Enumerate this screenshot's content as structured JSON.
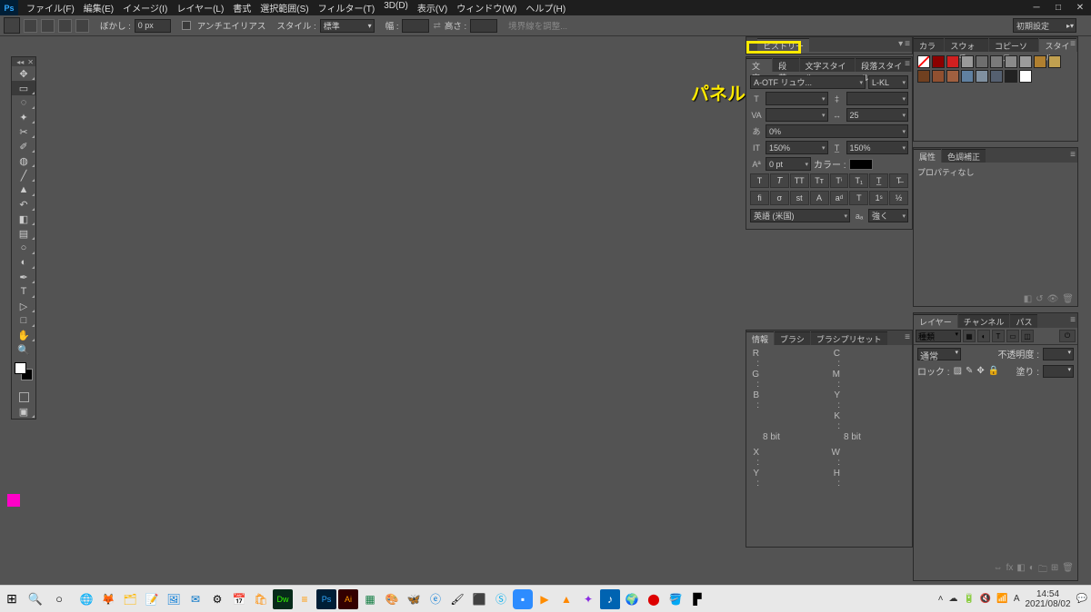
{
  "menu": {
    "file": "ファイル(F)",
    "edit": "編集(E)",
    "image": "イメージ(I)",
    "layer": "レイヤー(L)",
    "type": "書式",
    "select": "選択範囲(S)",
    "filter": "フィルター(T)",
    "threed": "3D(D)",
    "view": "表示(V)",
    "window": "ウィンドウ(W)",
    "help": "ヘルプ(H)"
  },
  "workspace": "初期設定",
  "options": {
    "feather_label": "ぼかし :",
    "feather_value": "0 px",
    "antialias": "アンチエイリアス",
    "style_label": "スタイル :",
    "style_value": "標準",
    "width_label": "幅 :",
    "width_value": "",
    "height_label": "高さ :",
    "height_value": "",
    "refine": "境界線を調整..."
  },
  "history_tab": "ヒストリー",
  "annotation": "パネルが最小化されました",
  "char_panel": {
    "tabs": [
      "文字",
      "段落",
      "文字スタイル",
      "段落スタイル"
    ],
    "font": "A-OTF リュウ...",
    "weight": "L-KL",
    "size": "",
    "leading": "",
    "va": "VA",
    "tracking": "25",
    "tsume": "0%",
    "vscale": "150%",
    "hscale": "150%",
    "baseline": "0 pt",
    "color_label": "カラー :",
    "lang": "英語 (米国)",
    "aa": "強く"
  },
  "info_panel": {
    "tabs": [
      "情報",
      "ブラシ",
      "ブラシプリセット"
    ],
    "r": "R :",
    "g": "G :",
    "b": "B :",
    "c": "C :",
    "m": "M :",
    "y": "Y :",
    "k": "K :",
    "bit": "8 bit",
    "bit2": "8 bit",
    "x": "X :",
    "yy": "Y :",
    "w": "W :",
    "h": "H :"
  },
  "right": {
    "style_tabs": [
      "カラー",
      "スウォッチ",
      "コピーソース",
      "スタイル"
    ],
    "swatches": [
      "#000000",
      "#8b0000",
      "#d02020",
      "#9a9a9a",
      "#6e6e6e",
      "#7a7a7a",
      "#8a8a8a",
      "#9c9c9c",
      "#b08030",
      "#c0a050",
      "#704020",
      "#905030",
      "#a06040",
      "#6080a0",
      "#8090a0",
      "#556070",
      "#222222",
      "#ffffff"
    ],
    "prop_tabs": [
      "属性",
      "色調補正"
    ],
    "prop_empty": "プロパティなし",
    "layer_tabs": [
      "レイヤー",
      "チャンネル",
      "パス"
    ],
    "layer_kind": "種類",
    "layer_mode": "通常",
    "layer_opacity_label": "不透明度 :",
    "layer_lock": "ロック :",
    "layer_fill": "塗り :"
  },
  "taskbar": {
    "time": "14:54",
    "date": "2021/08/02"
  }
}
